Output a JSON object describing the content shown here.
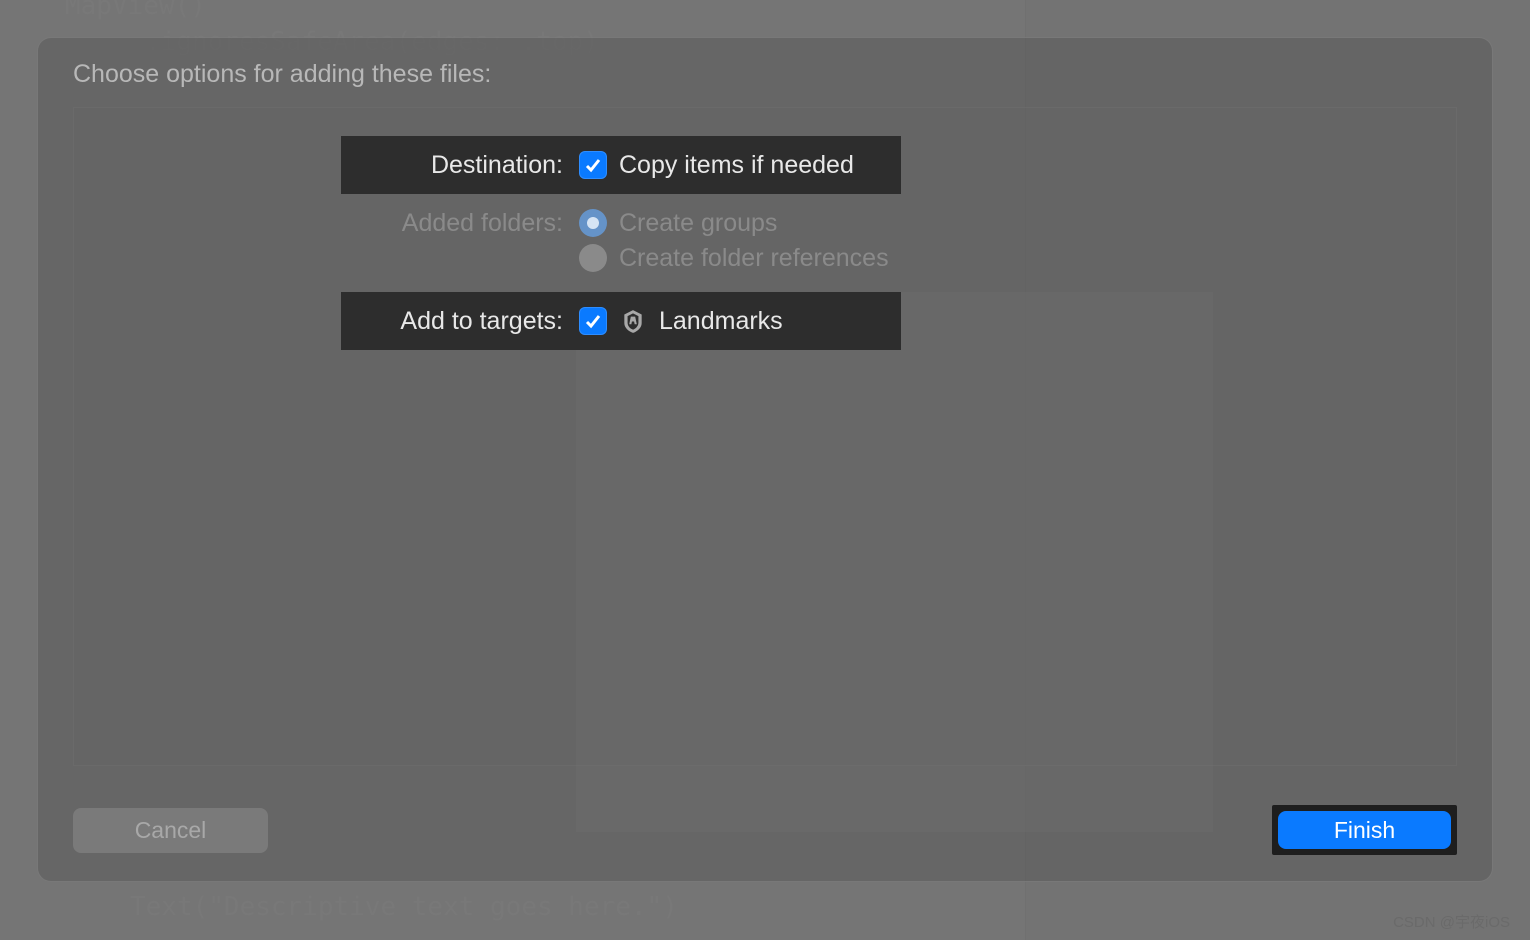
{
  "background_code": {
    "line1": "MapView()",
    "line2": ".ignoresSafeArea(edges: .top)",
    "line3": "Text(\"Descriptive text goes here.\")"
  },
  "dialog": {
    "title": "Choose options for adding these files:",
    "destination": {
      "label": "Destination:",
      "option": "Copy items if needed",
      "checked": true
    },
    "added_folders": {
      "label": "Added folders:",
      "option1": "Create groups",
      "option2": "Create folder references",
      "selected": "groups"
    },
    "targets": {
      "label": "Add to targets:",
      "items": [
        {
          "name": "Landmarks",
          "checked": true
        }
      ]
    }
  },
  "buttons": {
    "cancel": "Cancel",
    "finish": "Finish"
  },
  "watermark": "CSDN @宇夜iOS"
}
